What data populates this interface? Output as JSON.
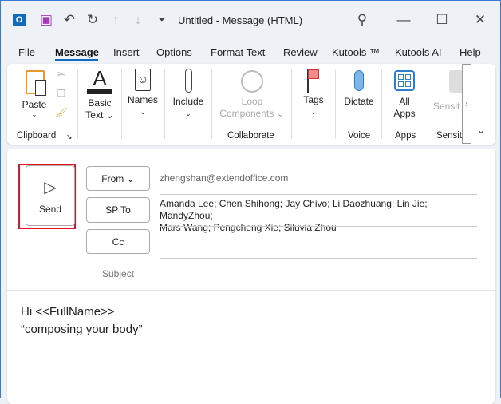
{
  "window": {
    "title": "Untitled  -  Message (HTML)"
  },
  "quick_access": [
    "outlook-icon",
    "save-icon",
    "undo-icon",
    "redo-icon",
    "up-icon",
    "down-icon",
    "customize-icon"
  ],
  "tabs": [
    "File",
    "Message",
    "Insert",
    "Options",
    "Format Text",
    "Review",
    "Kutools ™",
    "Kutools AI",
    "Help"
  ],
  "ribbon": {
    "paste": "Paste",
    "basic_text_1": "Basic",
    "basic_text_2": "Text",
    "names": "Names",
    "include": "Include",
    "loop_1": "Loop",
    "loop_2": "Components",
    "tags": "Tags",
    "dictate": "Dictate",
    "all_apps_1": "All",
    "all_apps_2": "Apps",
    "sensitivity": "Sensit",
    "groups": {
      "clipboard": "Clipboard",
      "collaborate": "Collaborate",
      "voice": "Voice",
      "apps": "Apps",
      "sensitivity": "Sensit"
    }
  },
  "compose": {
    "send": "Send",
    "from": "From",
    "to": "SP To",
    "cc": "Cc",
    "subject": "Subject",
    "from_value": "zhengshan@extendoffice.com",
    "recipients": [
      "Amanda Lee",
      "Chen Shihong",
      "Jay Chivo",
      "Li Daozhuang",
      "Lin Jie",
      "MandyZhou",
      "Mars Wang",
      "Pengcheng Xie",
      "Siluvia Zhou"
    ],
    "body_line1": "Hi <<FullName>>",
    "body_line2": "“composing your body”"
  },
  "colors": {
    "accent": "#0f6cbd",
    "highlight": "#e81123"
  }
}
